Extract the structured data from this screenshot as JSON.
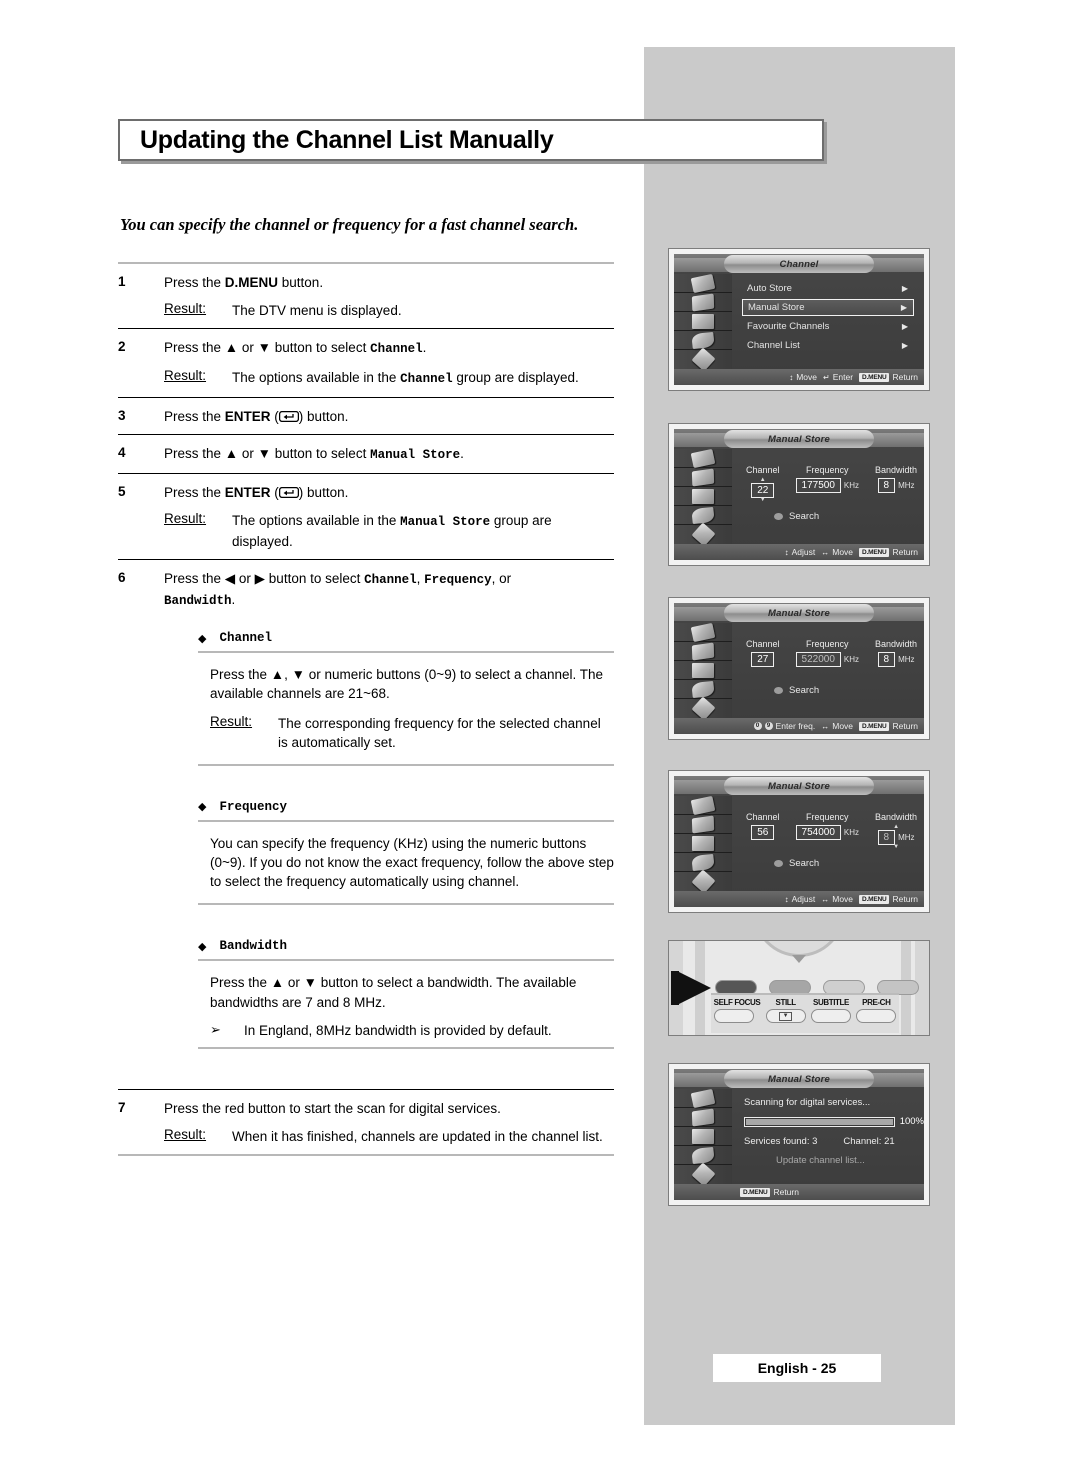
{
  "page": {
    "title": "Updating the Channel List Manually",
    "intro": "You can specify the channel or frequency for a fast channel search.",
    "footer": "English - 25"
  },
  "steps": [
    {
      "num": "1",
      "instruction_pre": "Press the ",
      "instruction_bold": "D.MENU",
      "instruction_post": " button.",
      "result_label": "Result:",
      "result_text": "The DTV menu is displayed."
    },
    {
      "num": "2",
      "instruction_pre": "Press the ▲ or ▼ button to select ",
      "instruction_mono": "Channel",
      "instruction_post": ".",
      "result_label": "Result:",
      "result_text_pre": "The options available in the ",
      "result_text_mono": "Channel",
      "result_text_post": " group are displayed."
    },
    {
      "num": "3",
      "instruction_pre": "Press the ",
      "instruction_bold": "ENTER",
      "instruction_post": " button.",
      "enter_icon": "enter-key-icon"
    },
    {
      "num": "4",
      "instruction_pre": "Press the ▲ or ▼ button to select ",
      "instruction_mono": "Manual Store",
      "instruction_post": "."
    },
    {
      "num": "5",
      "instruction_pre": "Press the ",
      "instruction_bold": "ENTER",
      "instruction_post": " button.",
      "enter_icon": "enter-key-icon",
      "result_label": "Result:",
      "result_text_pre": "The options available in the ",
      "result_text_mono": "Manual Store",
      "result_text_post": " group are displayed."
    },
    {
      "num": "6",
      "instruction_pre": "Press the ◀ or ▶ button to select ",
      "instruction_mono": "Channel",
      "instruction_mid": ", ",
      "instruction_mono2": "Frequency",
      "instruction_post": ", or ",
      "instruction_mono3": "Bandwidth",
      "instruction_end": "."
    },
    {
      "num": "7",
      "instruction_pre": "Press the red button to start the scan for digital services.",
      "result_label": "Result:",
      "result_text": "When it has finished, channels are updated in the channel list."
    }
  ],
  "subsections": [
    {
      "bullet": "◆",
      "title": "Channel",
      "body": "Press the ▲, ▼ or numeric buttons (0~9) to select a channel. The available channels are 21~68.",
      "result_label": "Result:",
      "result_text": "The corresponding frequency for the selected channel is automatically set."
    },
    {
      "bullet": "◆",
      "title": "Frequency",
      "body": "You can specify the frequency (KHz) using the numeric buttons (0~9). If you do not know the exact frequency, follow the above step to select the frequency automatically using channel."
    },
    {
      "bullet": "◆",
      "title": "Bandwidth",
      "body": "Press the ▲ or ▼ button to select a bandwidth. The available bandwidths are 7 and 8 MHz.",
      "note_arrow": "➢",
      "note": "In England, 8MHz bandwidth is provided by default."
    }
  ],
  "screenshots": {
    "channel_menu": {
      "title": "Channel",
      "items": [
        {
          "label": "Auto Store",
          "selected": false,
          "arrow": "▶"
        },
        {
          "label": "Manual Store",
          "selected": true,
          "arrow": "▶"
        },
        {
          "label": "Favourite Channels",
          "selected": false,
          "arrow": "▶"
        },
        {
          "label": "Channel List",
          "selected": false,
          "arrow": "▶"
        }
      ],
      "footer": [
        {
          "sym": "↕",
          "label": "Move"
        },
        {
          "sym": "↵",
          "label": "Enter"
        },
        {
          "tag": "D.MENU",
          "label": "Return"
        }
      ]
    },
    "manual_store_1": {
      "title": "Manual Store",
      "fields": {
        "channel_label": "Channel",
        "channel_value": "22",
        "frequency_label": "Frequency",
        "frequency_value": "177500",
        "frequency_unit": "KHz",
        "bandwidth_label": "Bandwidth",
        "bandwidth_value": "8",
        "bandwidth_unit": "MHz"
      },
      "search_label": "Search",
      "focus": "channel",
      "footer": [
        {
          "sym": "↕",
          "label": "Adjust"
        },
        {
          "sym": "↔",
          "label": "Move"
        },
        {
          "tag": "D.MENU",
          "label": "Return"
        }
      ]
    },
    "manual_store_2": {
      "title": "Manual Store",
      "fields": {
        "channel_label": "Channel",
        "channel_value": "27",
        "frequency_label": "Frequency",
        "frequency_value": "522000",
        "frequency_unit": "KHz",
        "bandwidth_label": "Bandwidth",
        "bandwidth_value": "8",
        "bandwidth_unit": "MHz"
      },
      "search_label": "Search",
      "focus": "frequency",
      "footer": [
        {
          "circles": [
            "0",
            "9"
          ],
          "label": "Enter freq."
        },
        {
          "sym": "↔",
          "label": "Move"
        },
        {
          "tag": "D.MENU",
          "label": "Return"
        }
      ]
    },
    "manual_store_3": {
      "title": "Manual Store",
      "fields": {
        "channel_label": "Channel",
        "channel_value": "56",
        "frequency_label": "Frequency",
        "frequency_value": "754000",
        "frequency_unit": "KHz",
        "bandwidth_label": "Bandwidth",
        "bandwidth_value": "8",
        "bandwidth_unit": "MHz"
      },
      "search_label": "Search",
      "focus": "bandwidth",
      "footer": [
        {
          "sym": "↕",
          "label": "Adjust"
        },
        {
          "sym": "↔",
          "label": "Move"
        },
        {
          "tag": "D.MENU",
          "label": "Return"
        }
      ]
    },
    "remote": {
      "buttons": [
        "SELF FOCUS",
        "STILL",
        "SUBTITLE",
        "PRE-CH"
      ],
      "still_glyph": "▼"
    },
    "scanning": {
      "title": "Manual Store",
      "status": "Scanning for digital services...",
      "progress_pct": "100%",
      "progress_value": 100,
      "services_found": "Services found: 3",
      "channel": "Channel: 21",
      "sub_status": "Update channel list...",
      "footer": [
        {
          "tag": "D.MENU",
          "label": "Return"
        }
      ]
    }
  }
}
